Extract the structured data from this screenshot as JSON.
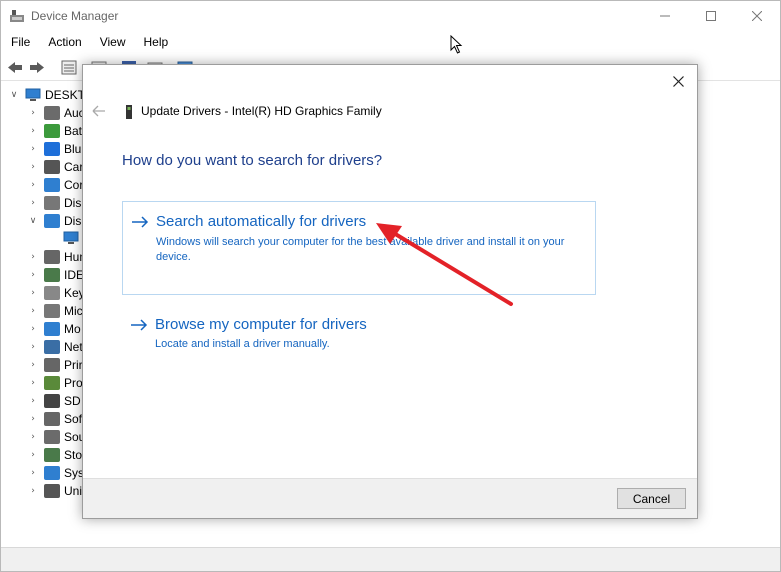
{
  "window": {
    "title": "Device Manager",
    "controls": [
      "minimize",
      "maximize",
      "close"
    ]
  },
  "menu": [
    "File",
    "Action",
    "View",
    "Help"
  ],
  "tree": {
    "root": "DESKTO",
    "items": [
      {
        "label": "Auc",
        "icon": "audio-icon",
        "color": "#6b6b6b",
        "expanded": false
      },
      {
        "label": "Bat",
        "icon": "battery-icon",
        "color": "#3c9a3c",
        "expanded": false
      },
      {
        "label": "Blu",
        "icon": "bluetooth-icon",
        "color": "#1e6fd9",
        "expanded": false
      },
      {
        "label": "Car",
        "icon": "camera-icon",
        "color": "#555555",
        "expanded": false
      },
      {
        "label": "Cor",
        "icon": "computer-icon",
        "color": "#2f7fd0",
        "expanded": false
      },
      {
        "label": "Disl",
        "icon": "disk-icon",
        "color": "#777777",
        "expanded": false
      },
      {
        "label": "Disp",
        "icon": "display-icon",
        "color": "#2f7fd0",
        "expanded": true
      },
      {
        "label": "Hun",
        "icon": "hid-icon",
        "color": "#666666",
        "expanded": false
      },
      {
        "label": "IDE",
        "icon": "ide-icon",
        "color": "#4a7a4a",
        "expanded": false
      },
      {
        "label": "Key",
        "icon": "keyboard-icon",
        "color": "#888888",
        "expanded": false
      },
      {
        "label": "Mic",
        "icon": "mouse-icon",
        "color": "#777777",
        "expanded": false
      },
      {
        "label": "Mo",
        "icon": "monitor-icon",
        "color": "#2f7fd0",
        "expanded": false
      },
      {
        "label": "Net",
        "icon": "network-icon",
        "color": "#3a6ea5",
        "expanded": false
      },
      {
        "label": "Prir",
        "icon": "print-queue-icon",
        "color": "#666666",
        "expanded": false
      },
      {
        "label": "Pro",
        "icon": "processor-icon",
        "color": "#5a8a3a",
        "expanded": false
      },
      {
        "label": "SD",
        "icon": "sd-card-icon",
        "color": "#444444",
        "expanded": false
      },
      {
        "label": "Sof",
        "icon": "software-device-icon",
        "color": "#666666",
        "expanded": false
      },
      {
        "label": "Sou",
        "icon": "sound-icon",
        "color": "#6b6b6b",
        "expanded": false
      },
      {
        "label": "Stor",
        "icon": "storage-icon",
        "color": "#4a7a4a",
        "expanded": false
      },
      {
        "label": "Sys",
        "icon": "system-devices-icon",
        "color": "#2f7fd0",
        "expanded": false
      },
      {
        "label": "Uni",
        "icon": "usb-icon",
        "color": "#555555",
        "expanded": false
      }
    ]
  },
  "dialog": {
    "heading": "Update Drivers - Intel(R) HD Graphics Family",
    "question": "How do you want to search for drivers?",
    "option_auto": {
      "title": "Search automatically for drivers",
      "description": "Windows will search your computer for the best available driver and install it on your device."
    },
    "option_browse": {
      "title": "Browse my computer for drivers",
      "description": "Locate and install a driver manually."
    },
    "cancel_label": "Cancel"
  },
  "colors": {
    "link": "#1565c0",
    "heading": "#1e3f8c",
    "annotation": "#e32228"
  }
}
